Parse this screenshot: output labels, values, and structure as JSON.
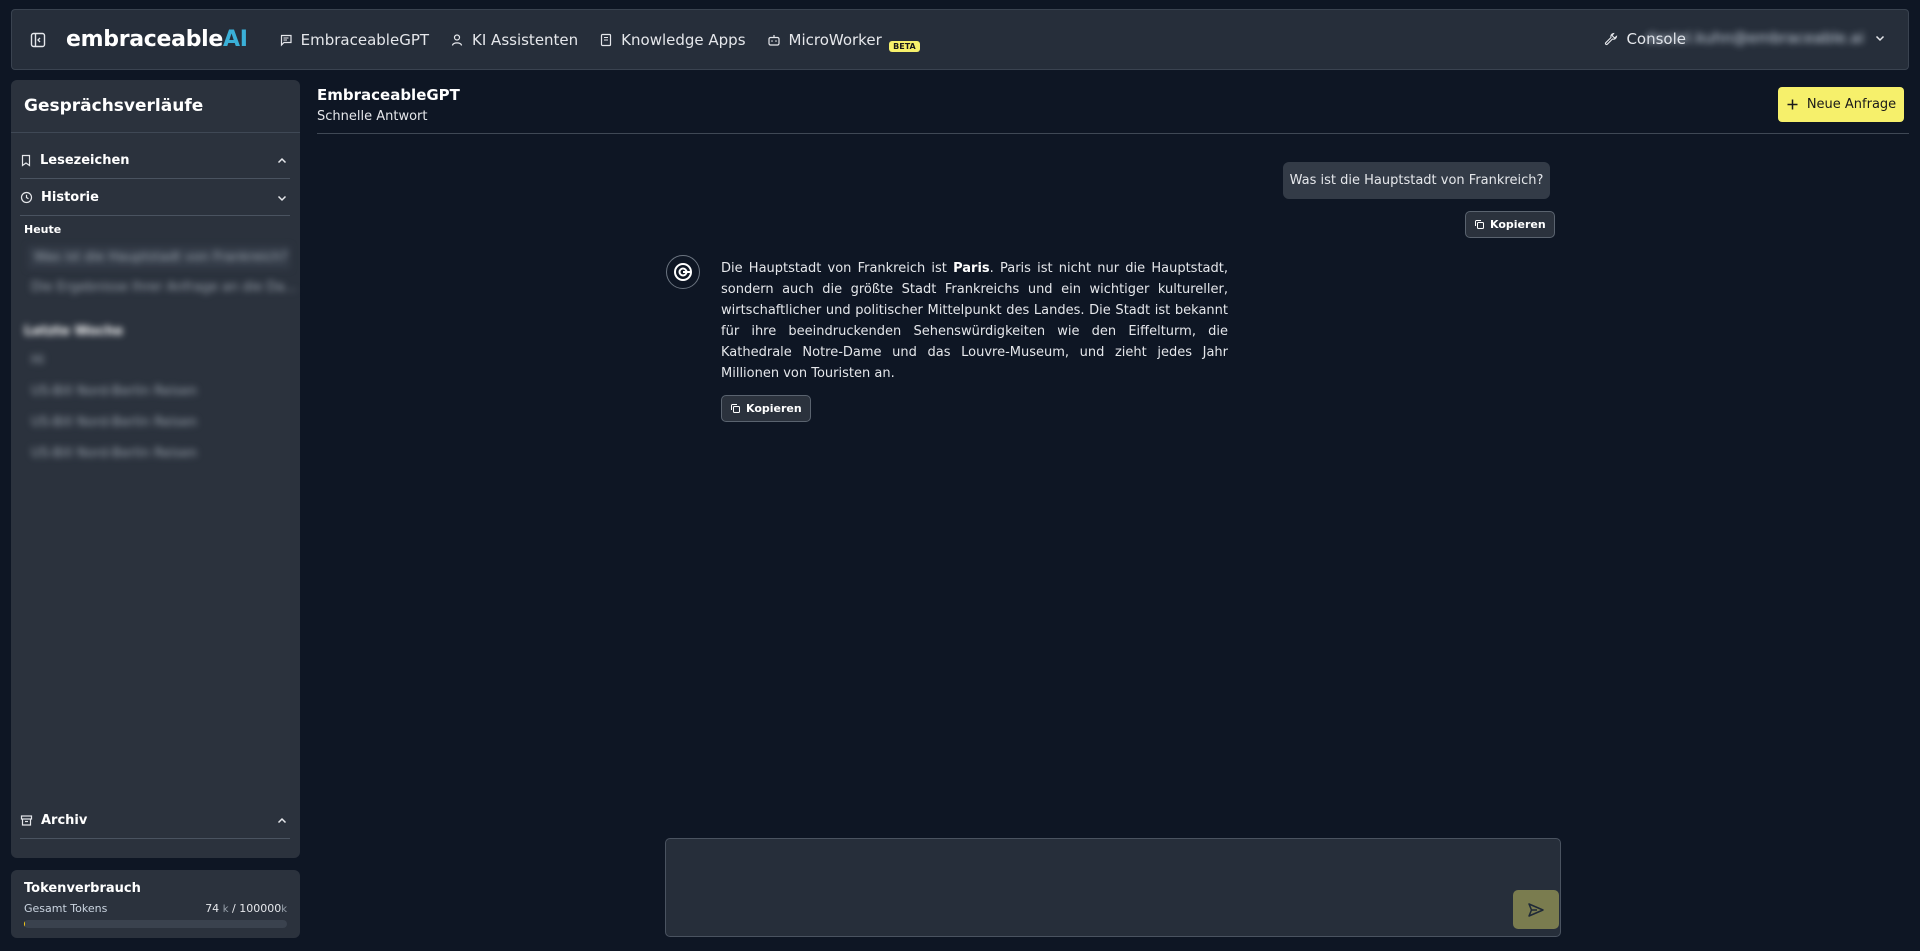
{
  "topbar": {
    "logo_main": "embraceable",
    "logo_ai": "AI",
    "nav": [
      {
        "label": "EmbraceableGPT",
        "icon": "chat-icon"
      },
      {
        "label": "KI Assistenten",
        "icon": "user-icon"
      },
      {
        "label": "Knowledge Apps",
        "icon": "book-icon"
      },
      {
        "label": "MicroWorker",
        "icon": "robot-icon",
        "badge": "BETA"
      }
    ],
    "console_label": "Console",
    "user_email": "daniel.kuhn@embraceable.ai"
  },
  "sidebar": {
    "title": "Gesprächsverläufe",
    "sections": {
      "bookmarks": "Lesezeichen",
      "history": "Historie",
      "archive": "Archiv"
    },
    "today_label": "Heute",
    "today_items": [
      "Was ist die Hauptstadt von Frankreich?",
      "Die Ergebnisse Ihrer Anfrage an die Da..."
    ],
    "last_week_label": "Letzte Woche",
    "last_week_items": [
      "Hi",
      "US-Bill Nord-Berlin Reisen",
      "US-Bill Nord-Berlin Reisen",
      "US-Bill Nord-Berlin Reisen"
    ]
  },
  "tokens": {
    "title": "Tokenverbrauch",
    "label": "Gesamt Tokens",
    "used": "74",
    "total": "100000",
    "unit": "k",
    "separator": "/",
    "fraction_used": 0.00074
  },
  "chat": {
    "title": "EmbraceableGPT",
    "subtitle": "Schnelle Antwort",
    "new_button": "Neue Anfrage",
    "user_message": "Was ist die Hauptstadt von Frankreich?",
    "copy_label": "Kopieren",
    "answer_pre": "Die Hauptstadt von Frankreich ist ",
    "answer_bold": "Paris",
    "answer_post": ". Paris ist nicht nur die Hauptstadt, sondern auch die größte Stadt Frankreichs und ein wichtiger kultureller, wirtschaftlicher und politischer Mittelpunkt des Landes. Die Stadt ist bekannt für ihre beeindruckenden Sehenswürdigkeiten wie den Eiffelturm, die Kathedrale Notre-Dame und das Louvre-Museum, und zieht jedes Jahr Millionen von Touristen an.",
    "input_placeholder": ""
  },
  "colors": {
    "accent": "#f6f06b",
    "brand_ai": "#3ab0d8",
    "background": "#0e1624"
  }
}
